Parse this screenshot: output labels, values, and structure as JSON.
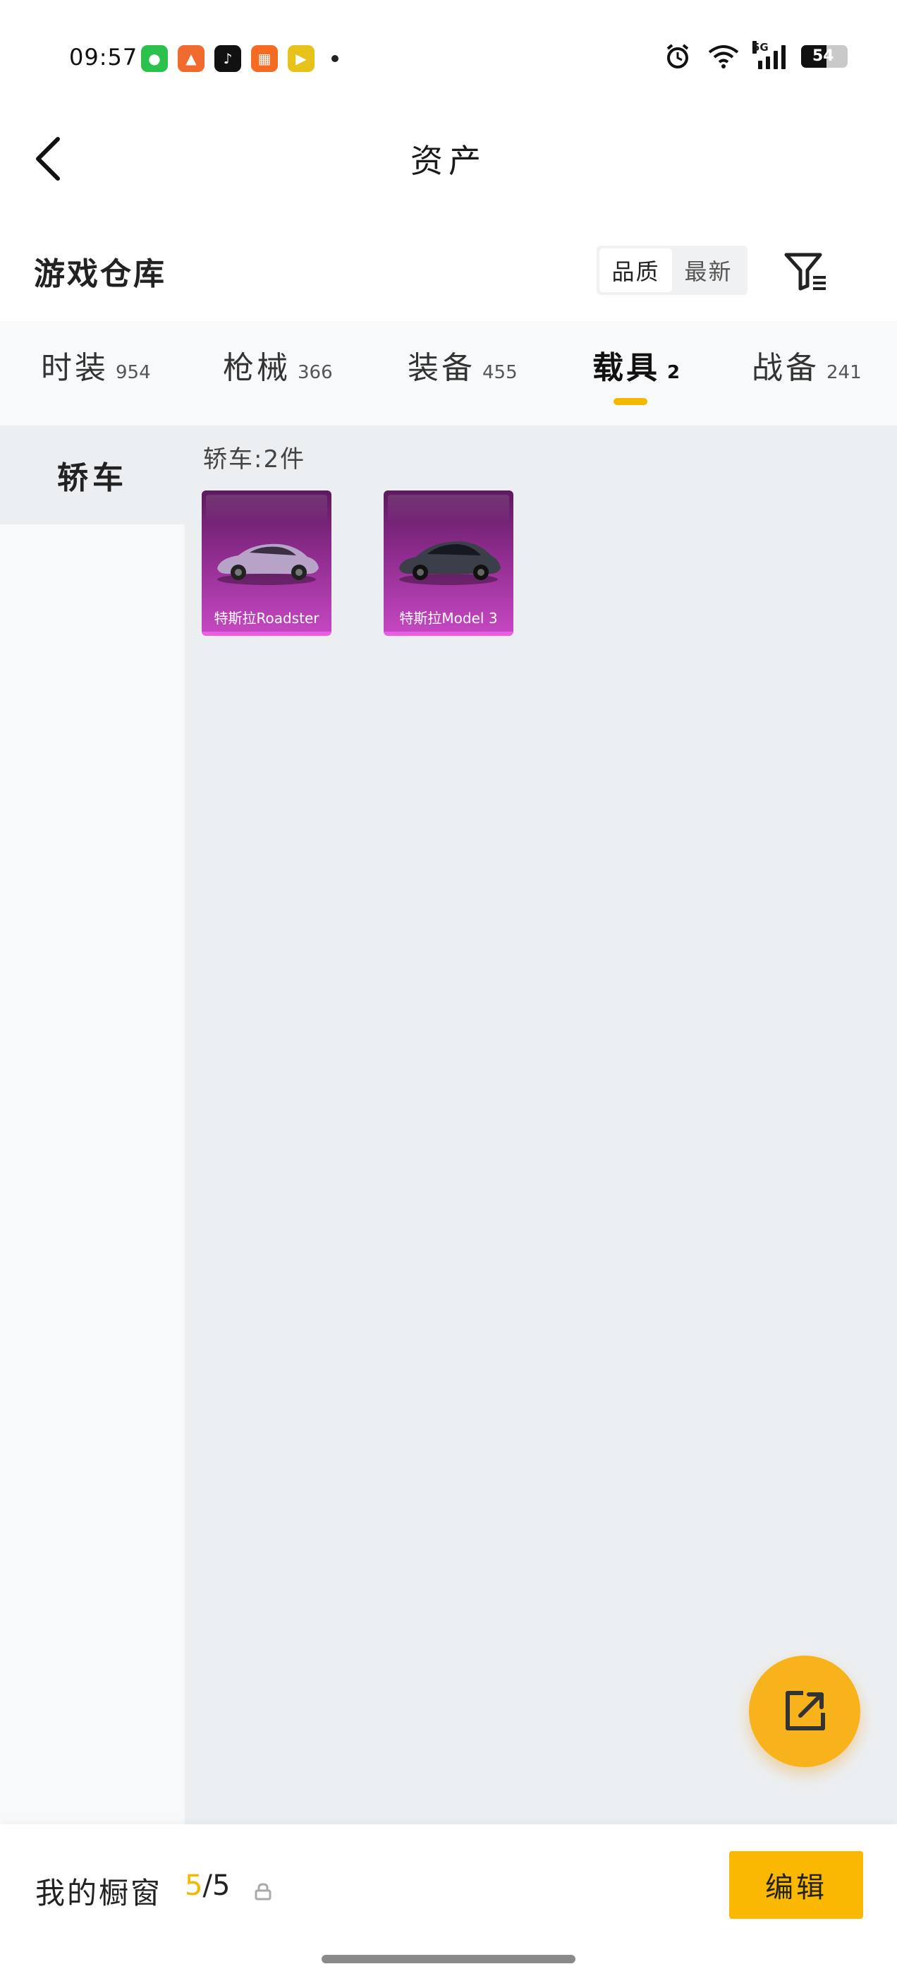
{
  "status_bar": {
    "time": "09:57",
    "apps": [
      {
        "icon": "wechat-icon",
        "color": "#2bc14b",
        "glyph": "●"
      },
      {
        "icon": "game-icon",
        "color": "#f06b2d",
        "glyph": "▲"
      },
      {
        "icon": "tiktok-icon",
        "color": "#111111",
        "glyph": "♪"
      },
      {
        "icon": "app-orange-icon",
        "color": "#f46b21",
        "glyph": "▦"
      },
      {
        "icon": "video-app-icon",
        "color": "#e6c21a",
        "glyph": "▶"
      }
    ],
    "network": "5G",
    "battery": "54",
    "battery_level": 0.54
  },
  "header": {
    "title": "资产",
    "back_icon": "chevron-left-icon"
  },
  "warehouse": {
    "title": "游戏仓库",
    "sort_options": [
      "品质",
      "最新"
    ],
    "active_sort": 0,
    "filter_icon": "filter-icon"
  },
  "tabs": [
    {
      "label": "时装",
      "count": "954"
    },
    {
      "label": "枪械",
      "count": "366"
    },
    {
      "label": "装备",
      "count": "455"
    },
    {
      "label": "载具",
      "count": "2",
      "active": true
    },
    {
      "label": "战备",
      "count": "241"
    }
  ],
  "sidebar": {
    "items": [
      {
        "label": "轿车",
        "active": true
      }
    ]
  },
  "content": {
    "group_title": "轿车:2件",
    "items": [
      {
        "name": "特斯拉Roadster",
        "car_color": "#b8a3c8"
      },
      {
        "name": "特斯拉Model 3",
        "car_color": "#3a3f4a"
      }
    ]
  },
  "fab": {
    "icon": "share-icon"
  },
  "bottom_bar": {
    "label": "我的橱窗",
    "current": "5",
    "separator": "/",
    "total": "5",
    "lock_icon": "lock-icon",
    "edit_label": "编辑"
  },
  "colors": {
    "accent": "#f5b800",
    "card_gradient_top": "#5d1a5e",
    "card_gradient_bottom": "#c447c1"
  }
}
